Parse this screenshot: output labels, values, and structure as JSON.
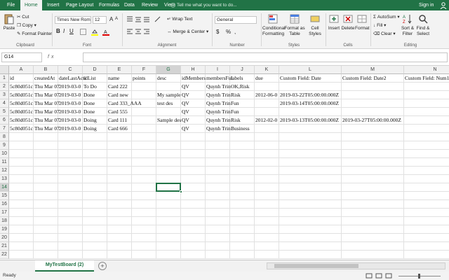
{
  "menu": {
    "tabs": [
      "File",
      "Home",
      "Insert",
      "Page Layout",
      "Formulas",
      "Data",
      "Review",
      "View"
    ],
    "active": "Home",
    "tell_me": "Tell me what you want to do...",
    "sign_in": "Sign in"
  },
  "ribbon": {
    "clipboard": {
      "label": "Clipboard",
      "paste": "Paste",
      "cut": "Cut",
      "copy": "Copy",
      "format_painter": "Format Painter"
    },
    "font": {
      "label": "Font",
      "font_name": "Times New Roma",
      "font_size": "12",
      "grow": "A",
      "shrink": "A",
      "bold": "B",
      "italic": "I",
      "underline": "U"
    },
    "alignment": {
      "label": "Alignment",
      "wrap_text": "Wrap Text",
      "merge_center": "Merge & Center"
    },
    "number": {
      "label": "Number",
      "format": "General",
      "currency": "$",
      "percent": "%",
      "comma": ","
    },
    "styles": {
      "label": "Styles",
      "conditional": "Conditional",
      "conditional2": "Formatting",
      "format_as": "Format as",
      "format_as2": "Table",
      "cell": "Cell",
      "cell2": "Styles"
    },
    "cells": {
      "label": "Cells",
      "insert": "Insert",
      "delete": "Delete",
      "format": "Format"
    },
    "editing": {
      "label": "Editing",
      "autosum": "AutoSum",
      "fill": "Fill",
      "clear": "Clear",
      "sort": "Sort &",
      "sort2": "Filter",
      "find": "Find &",
      "find2": "Select"
    }
  },
  "formula_bar": {
    "name_box": "G14",
    "fx": "fx",
    "value": ""
  },
  "columns": [
    "A",
    "B",
    "C",
    "D",
    "E",
    "F",
    "G",
    "H",
    "I",
    "J",
    "K",
    "L",
    "M",
    "N"
  ],
  "rows": [
    "1",
    "2",
    "3",
    "4",
    "5",
    "6",
    "7",
    "8",
    "9",
    "10",
    "11",
    "12",
    "13",
    "14",
    "15",
    "16",
    "17",
    "18",
    "19",
    "20",
    "21",
    "22"
  ],
  "cells": [
    [
      "id",
      "createdAt",
      "dateLastActi",
      "idList",
      "name",
      "points",
      "desc",
      "idMembers",
      "membersFul",
      "labels",
      "due",
      "Custom Field: Date",
      "Custom Field: Date2",
      "Custom Field: Num1"
    ],
    [
      "5c80d051c",
      "Thu Mar 07",
      "2019-03-0",
      "To Do",
      "Card 222",
      "",
      "",
      "QV",
      "Quynh Trin",
      "OK,Risk",
      "",
      "",
      "",
      ""
    ],
    [
      "5c80d051c",
      "Thu Mar 07",
      "2019-03-0",
      "Done",
      "Card new",
      "",
      "My sample",
      "QV",
      "Quynh Trin",
      "Risk",
      "2012-06-0",
      "2019-03-22T05:00:00.000Z",
      "",
      ""
    ],
    [
      "5c80d051c",
      "Thu Mar 07",
      "2019-03-0",
      "Done",
      "Card 333_AAA",
      "",
      "test des",
      "QV",
      "Quynh Trin",
      "Fun",
      "",
      "2019-03-14T05:00:00.000Z",
      "",
      ""
    ],
    [
      "5c80d051c",
      "Thu Mar 07",
      "2019-03-0",
      "Done",
      "Card 555",
      "",
      "",
      "QV",
      "Quynh Trin",
      "Fun",
      "",
      "",
      "",
      ""
    ],
    [
      "5c80d051c",
      "Thu Mar 07",
      "2019-03-0",
      "Doing",
      "Card 111",
      "",
      "Sample des",
      "QV",
      "Quynh Trin",
      "Risk",
      "2012-02-0",
      "2019-03-13T05:00:00.000Z",
      "2019-03-27T05:00:00.000Z",
      "1000"
    ],
    [
      "5c80d051c",
      "Thu Mar 07",
      "2019-03-0",
      "Doing",
      "Card 666",
      "",
      "",
      "QV",
      "Quynh Trin",
      "Business",
      "",
      "",
      "",
      ""
    ]
  ],
  "sheet": {
    "tab": "MyTestBoard (2)"
  },
  "status": {
    "text": "Ready"
  },
  "colors": {
    "accent": "#217346"
  }
}
